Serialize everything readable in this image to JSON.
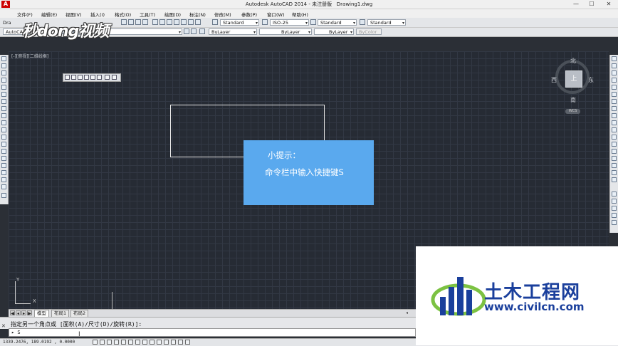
{
  "window": {
    "app_title": "Autodesk AutoCAD 2014 - 未注册版",
    "file_name": "Drawing1.dwg",
    "app_icon": "A",
    "minimize": "—",
    "maximize": "☐",
    "close": "✕"
  },
  "menubar": [
    "文件(F)",
    "编辑(E)",
    "视图(V)",
    "插入(I)",
    "格式(O)",
    "工具(T)",
    "绘图(D)",
    "标注(N)",
    "修改(M)",
    "参数(P)",
    "窗口(W)",
    "帮助(H)"
  ],
  "toolbar1": {
    "doc_tab": "Dra",
    "text_style": "Standard",
    "dim_style": "ISO-25",
    "table_style": "Standard",
    "multileader_style": "Standard"
  },
  "toolbar2": {
    "workspace": "AutoCAD 经典",
    "layer": "0",
    "color": "ByLayer",
    "linetype": "ByLayer",
    "lineweight": "ByLayer",
    "plotstyle": "ByColor"
  },
  "viewport": {
    "label": "[-][俯视][二维线框]"
  },
  "viewcube": {
    "face": "上",
    "north": "北",
    "south": "南",
    "east": "东",
    "west": "西",
    "wcs": "WCS"
  },
  "ucs": {
    "x": "X",
    "y": "Y"
  },
  "tip": {
    "title": "小提示：",
    "body": "命令栏中输入快捷键S"
  },
  "tabs": {
    "model": "模型",
    "layout1": "布局1",
    "layout2": "布局2"
  },
  "command": {
    "history": "指定另一个角点或 [面积(A)/尺寸(D)/旋转(R)]:",
    "prompt": "▸ S",
    "close_icon": "✕"
  },
  "status": {
    "coords": "1339.2476, 189.0192 , 0.0000"
  },
  "watermark_top": {
    "text": "秒dong视频"
  },
  "watermark_bottom": {
    "name": "土木工程网",
    "url": "www.civilcn.com"
  },
  "colors": {
    "tip_bg": "#5aa9ee",
    "canvas_bg": "#262b34",
    "brand_blue": "#1a3f9c",
    "logo_green": "#7cc242"
  }
}
